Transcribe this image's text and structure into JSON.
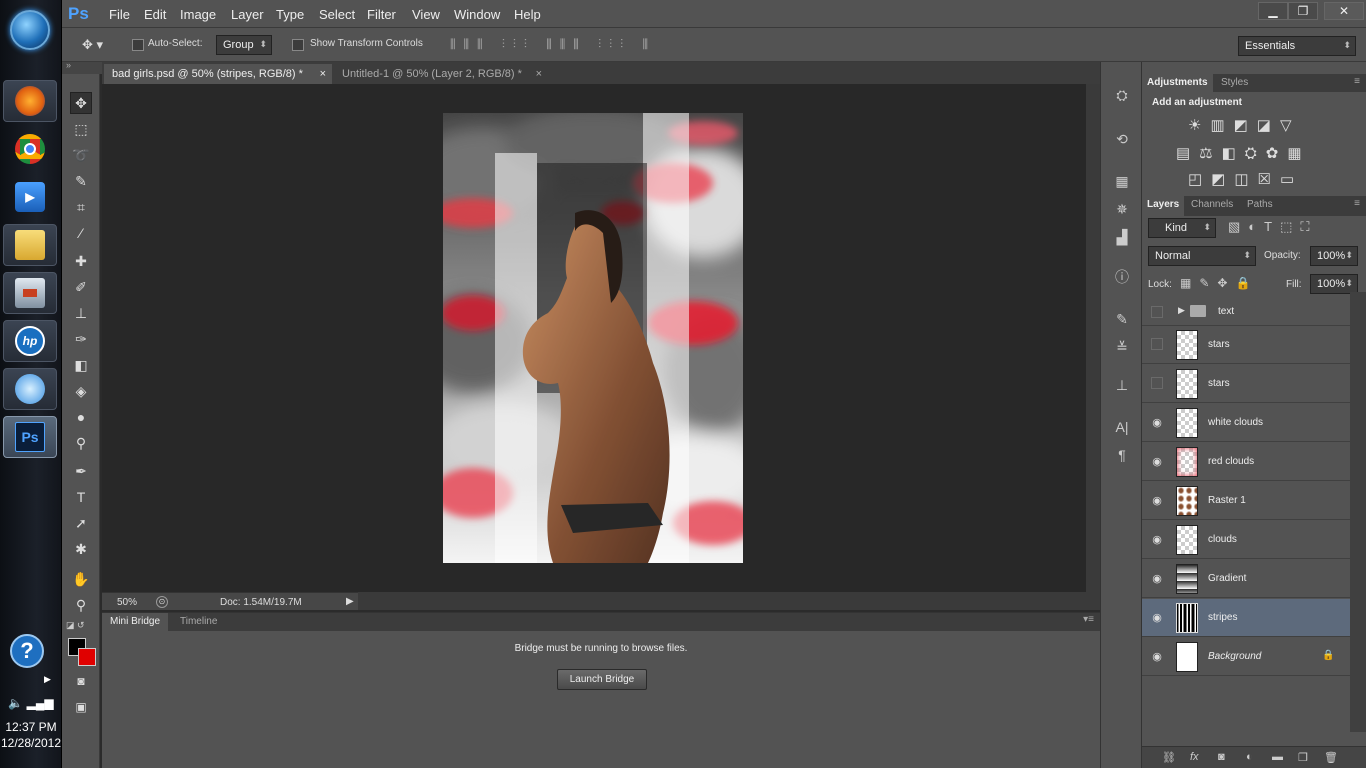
{
  "taskbar": {
    "time": "12:37 PM",
    "date": "12/28/2012",
    "items": [
      {
        "name": "firefox",
        "color": "#e86a17"
      },
      {
        "name": "chrome",
        "color": "#e0b020"
      },
      {
        "name": "media-player",
        "color": "#2f7fd8"
      },
      {
        "name": "explorer",
        "color": "#e8c54a"
      },
      {
        "name": "remote",
        "color": "#c84020"
      },
      {
        "name": "hp",
        "color": "#1a6fc0"
      },
      {
        "name": "flash",
        "color": "#6fb8ff"
      },
      {
        "name": "photoshop",
        "color": "#1f4f9a"
      }
    ],
    "ps_label": "Ps",
    "hp_label": "hp"
  },
  "app": {
    "logo": "Ps",
    "menus": [
      "File",
      "Edit",
      "Image",
      "Layer",
      "Type",
      "Select",
      "Filter",
      "View",
      "Window",
      "Help"
    ],
    "window_controls": {
      "min": "▁",
      "restore": "❐",
      "close": "✕"
    }
  },
  "options": {
    "auto_select_label": "Auto-Select:",
    "auto_select_value": "Group",
    "show_transform_label": "Show Transform Controls",
    "workspace": "Essentials"
  },
  "documents": {
    "tabs": [
      {
        "label": "bad girls.psd @ 50% (stripes, RGB/8) *",
        "close": "×"
      },
      {
        "label": "Untitled-1 @ 50% (Layer 2, RGB/8) *",
        "close": "×"
      }
    ]
  },
  "status": {
    "zoom": "50%",
    "doc": "Doc: 1.54M/19.7M"
  },
  "minibridge": {
    "tabs": [
      "Mini Bridge",
      "Timeline"
    ],
    "message": "Bridge must be running to browse files.",
    "button": "Launch Bridge"
  },
  "adjustments": {
    "tabs": [
      "Adjustments",
      "Styles"
    ],
    "heading": "Add an adjustment"
  },
  "layers_panel": {
    "tabs": [
      "Layers",
      "Channels",
      "Paths"
    ],
    "filter": "Kind",
    "blend_mode": "Normal",
    "opacity_label": "Opacity:",
    "opacity": "100%",
    "lock_label": "Lock:",
    "fill_label": "Fill:",
    "fill": "100%",
    "layers": [
      {
        "name": "text",
        "visible": false,
        "group": true
      },
      {
        "name": "stars",
        "visible": false
      },
      {
        "name": "stars",
        "visible": false
      },
      {
        "name": "white clouds",
        "visible": true
      },
      {
        "name": "red clouds",
        "visible": true
      },
      {
        "name": "Raster 1",
        "visible": true
      },
      {
        "name": "clouds",
        "visible": true
      },
      {
        "name": "Gradient",
        "visible": true
      },
      {
        "name": "stripes",
        "visible": true,
        "selected": true
      },
      {
        "name": "Background",
        "visible": true,
        "locked": true
      }
    ]
  },
  "colors": {
    "foreground": "#000000",
    "background": "#e00000",
    "selected_layer": "#5d6a7c"
  }
}
